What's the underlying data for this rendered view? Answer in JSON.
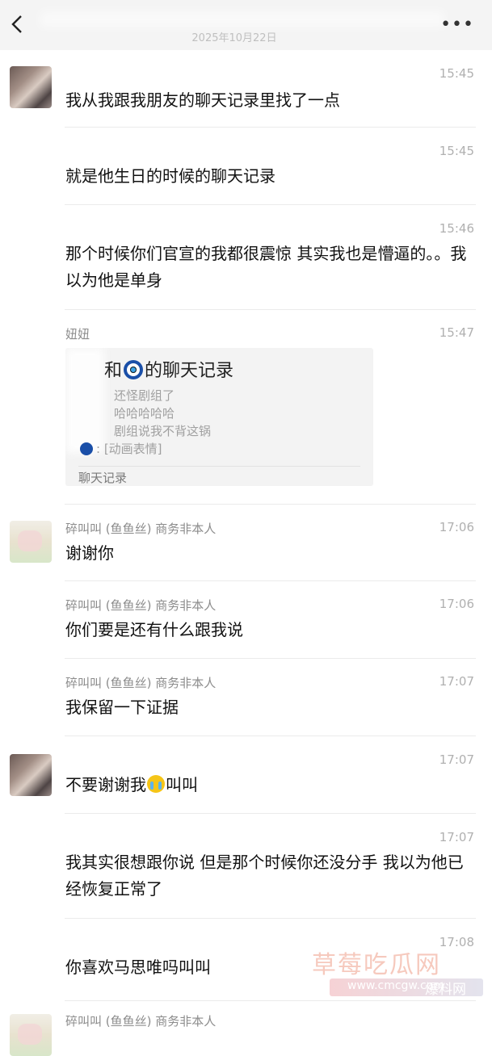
{
  "header": {
    "date": "2025年10月22日",
    "more_label": "•••"
  },
  "messages": [
    {
      "time": "15:45",
      "text": "我从我跟我朋友的聊天记录里找了一点"
    },
    {
      "time": "15:45",
      "text": "就是他生日的时候的聊天记录"
    },
    {
      "time": "15:46",
      "text": "那个时候你们官宣的我都很震惊 其实我也是懵逼的。。我以为他是单身"
    },
    {
      "sender": "妞妞",
      "time": "15:47",
      "card": {
        "title_pre": "和",
        "title_post": "的聊天记录",
        "lines": [
          "还怪剧组了",
          "哈哈哈哈哈",
          "剧组说我不背这锅",
          ": [动画表情]"
        ],
        "footer": "聊天记录"
      }
    },
    {
      "sender": "碎叫叫 (鱼鱼丝) 商务非本人",
      "time": "17:06",
      "text": "谢谢你"
    },
    {
      "sender": "碎叫叫 (鱼鱼丝) 商务非本人",
      "time": "17:06",
      "text": "你们要是还有什么跟我说"
    },
    {
      "sender": "碎叫叫 (鱼鱼丝) 商务非本人",
      "time": "17:07",
      "text": "我保留一下证据"
    },
    {
      "time": "17:07",
      "text_pre": "不要谢谢我",
      "text_post": "叫叫"
    },
    {
      "time": "17:07",
      "text": "我其实很想跟你说 但是那个时候你还没分手 我以为他已经恢复正常了"
    },
    {
      "time": "17:08",
      "text": "你喜欢马思唯吗叫叫"
    },
    {
      "sender": "碎叫叫 (鱼鱼丝) 商务非本人"
    }
  ],
  "watermark": {
    "main": "草莓吃瓜网",
    "url": "www.cmcgw.com",
    "tag": "爆料网"
  }
}
